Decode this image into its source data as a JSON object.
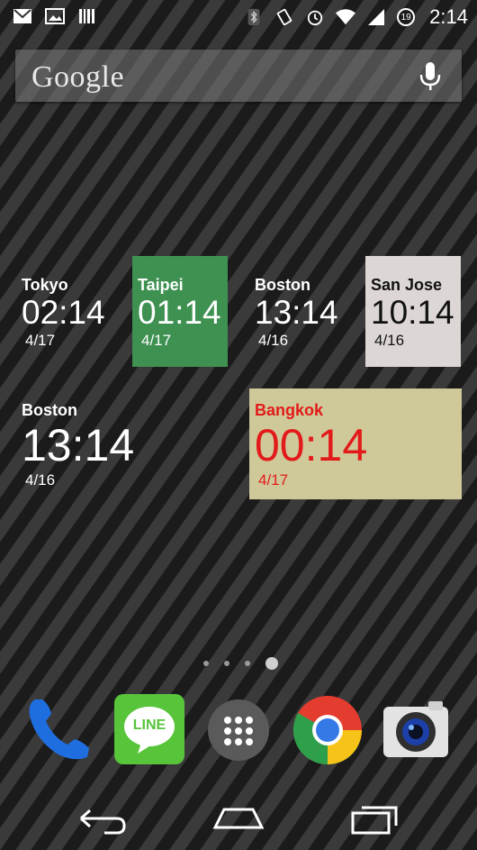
{
  "status_bar": {
    "time": "2:14",
    "battery_level": "19",
    "notifications": [
      "gmail-icon",
      "gallery-icon",
      "barcode-icon"
    ],
    "system_icons": [
      "bluetooth-icon",
      "vibrate-icon",
      "alarm-icon",
      "wifi-icon",
      "signal-icon"
    ]
  },
  "search": {
    "logo_text": "Google"
  },
  "clocks": [
    {
      "city": "Tokyo",
      "time": "02:14",
      "date": "4/17",
      "bg": "transparent",
      "fg": "#ffffff"
    },
    {
      "city": "Taipei",
      "time": "01:14",
      "date": "4/17",
      "bg": "#3e9151",
      "fg": "#ffffff"
    },
    {
      "city": "Boston",
      "time": "13:14",
      "date": "4/16",
      "bg": "transparent",
      "fg": "#ffffff"
    },
    {
      "city": "San Jose",
      "time": "10:14",
      "date": "4/16",
      "bg": "#dcd7d5",
      "fg": "#111111"
    },
    {
      "city": "Boston",
      "time": "13:14",
      "date": "4/16",
      "bg": "transparent",
      "fg": "#ffffff"
    },
    {
      "city": "Bangkok",
      "time": "00:14",
      "date": "4/17",
      "bg": "#cfc999",
      "fg": "#e31a1a"
    }
  ],
  "page_indicator": {
    "count": 4,
    "active": 4
  },
  "dock": [
    {
      "name": "Phone",
      "icon": "phone-icon"
    },
    {
      "name": "LINE",
      "label": "LINE",
      "icon": "line-icon"
    },
    {
      "name": "Apps",
      "icon": "app-drawer-icon"
    },
    {
      "name": "Chrome",
      "icon": "chrome-icon"
    },
    {
      "name": "Camera",
      "icon": "camera-icon"
    }
  ],
  "nav": [
    "back-icon",
    "home-icon",
    "recents-icon"
  ]
}
